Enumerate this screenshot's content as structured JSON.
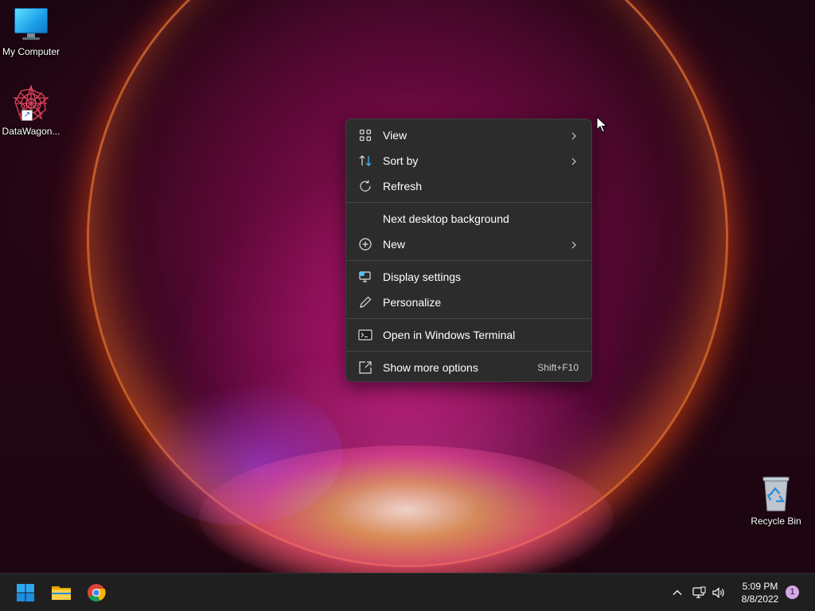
{
  "desktop": {
    "icons": [
      {
        "label": "My Computer"
      },
      {
        "label": "DataWagon..."
      },
      {
        "label": "Recycle Bin"
      }
    ]
  },
  "context_menu": {
    "items": [
      {
        "label": "View",
        "icon": "grid-icon",
        "submenu": true
      },
      {
        "label": "Sort by",
        "icon": "sort-icon",
        "submenu": true
      },
      {
        "label": "Refresh",
        "icon": "refresh-icon",
        "submenu": false
      },
      {
        "label": "Next desktop background",
        "icon": "",
        "submenu": false
      },
      {
        "label": "New",
        "icon": "plus-circle-icon",
        "submenu": true
      },
      {
        "label": "Display settings",
        "icon": "display-settings-icon",
        "submenu": false
      },
      {
        "label": "Personalize",
        "icon": "pen-icon",
        "submenu": false
      },
      {
        "label": "Open in Windows Terminal",
        "icon": "terminal-icon",
        "submenu": false
      },
      {
        "label": "Show more options",
        "icon": "more-options-icon",
        "shortcut": "Shift+F10"
      }
    ]
  },
  "taskbar": {
    "apps": [
      {
        "name": "Start",
        "icon": "windows-start-icon"
      },
      {
        "name": "File Explorer",
        "icon": "folder-icon"
      },
      {
        "name": "Google Chrome",
        "icon": "chrome-icon"
      }
    ],
    "tray": {
      "time": "5:09 PM",
      "date": "8/8/2022",
      "notifications": "1"
    }
  },
  "colors": {
    "menu_bg": "#2c2c2c",
    "taskbar_bg": "#1f1f1f",
    "accent": "#4cc2ff"
  }
}
